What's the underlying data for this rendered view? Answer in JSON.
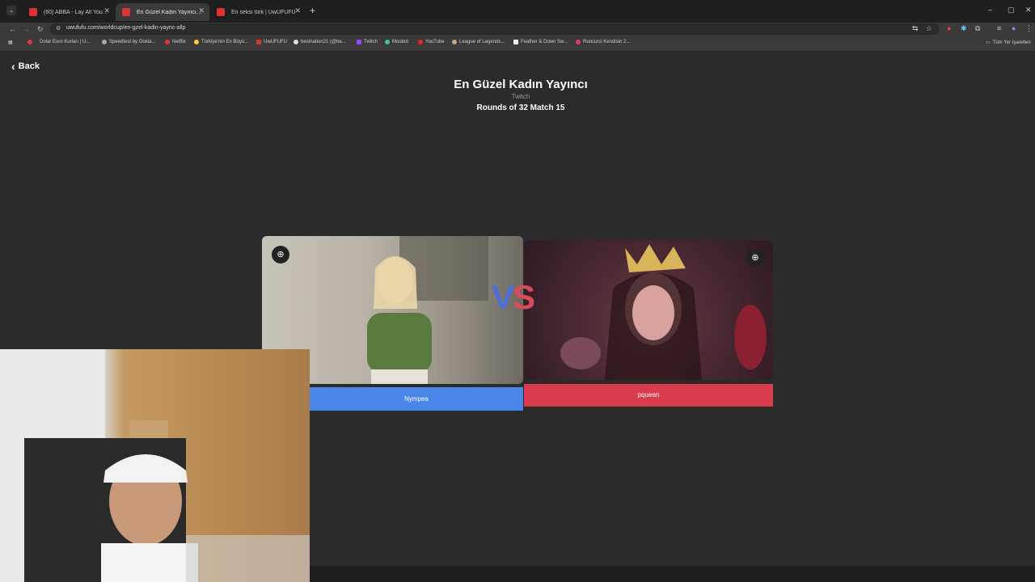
{
  "browser": {
    "tabs": [
      {
        "title": "(60) ABBA - Lay All Your Love O",
        "active": false
      },
      {
        "title": "En Güzel Kadın Yayıncı | UwUF",
        "active": true
      },
      {
        "title": "En seksi türk | UwUFUFU",
        "active": false
      }
    ],
    "new_tab": "+",
    "url": "uwufufu.com/worldcup/en-gzel-kadin-yaync-allp",
    "bookmarks": [
      "Dolar Euro Kurları | U...",
      "Speedtest by Ookla...",
      "Netflix",
      "Türkiye'nin En Büyü...",
      "UwUFUFU",
      "bestnation21 (@be...",
      "Twitch",
      "Moobot",
      "YouTube",
      "League of Legends...",
      "Feather & Down Sw...",
      "Runcurci Kendisin 2..."
    ],
    "all_bookmarks": "Tüm Yer İşaretleri",
    "window_controls": [
      "–",
      "▢",
      "✕"
    ]
  },
  "page": {
    "back_label": "Back",
    "title": "En Güzel Kadın Yayıncı",
    "subtitle": "Twitch",
    "round_info": "Rounds of 32 Match 15",
    "vs_v": "V",
    "vs_s": "S",
    "left_candidate": "Nympea",
    "right_candidate": "pqueen"
  },
  "colors": {
    "left_accent": "#4a86e8",
    "right_accent": "#d93c4c",
    "background": "#2b2b2b"
  },
  "icons": {
    "zoom": "zoom-in-icon",
    "back": "chevron-left-icon"
  }
}
